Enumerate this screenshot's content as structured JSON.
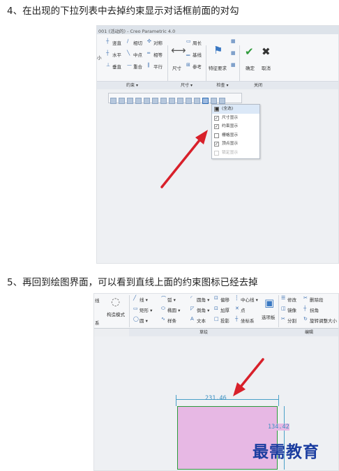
{
  "step4": "4、在出现的下拉列表中去掉约束显示对话框前面的对勾",
  "step5": "5、再回到绘图界面，可以看到直线上面的约束图标已经去掉",
  "shot1": {
    "window_title": "001 (活动的) - Creo Parametric 4.0",
    "constraints": {
      "row1": [
        "竖直",
        "相切",
        "对称"
      ],
      "row2": [
        "水平",
        "中点",
        "相等"
      ],
      "row3": [
        "垂直",
        "重合",
        "平行"
      ],
      "left_edge": "小",
      "group": "约束 ▾"
    },
    "dimension": {
      "label": "尺寸",
      "items": [
        "周长",
        "基线",
        "参考"
      ],
      "group": "尺寸 ▾"
    },
    "inspect": {
      "label": "特征要求",
      "group": "检查 ▾"
    },
    "close": {
      "ok": "确定",
      "cancel": "取消",
      "group": "关闭"
    },
    "dropdown": [
      {
        "label": "(全选)",
        "checked": true,
        "disabled": false,
        "highlight": true
      },
      {
        "label": "尺寸显示",
        "checked": true,
        "disabled": false,
        "highlight": false
      },
      {
        "label": "约束显示",
        "checked": true,
        "disabled": false,
        "highlight": false
      },
      {
        "label": "栅格显示",
        "checked": false,
        "disabled": false,
        "highlight": false
      },
      {
        "label": "顶点显示",
        "checked": true,
        "disabled": false,
        "highlight": false
      },
      {
        "label": "锁定显示",
        "checked": false,
        "disabled": true,
        "highlight": false
      }
    ]
  },
  "shot2": {
    "left_edge": [
      "线",
      "系"
    ],
    "construct_mode": "构造模式",
    "sketch_tools": {
      "col1": [
        "线 ▾",
        "矩形 ▾",
        "圆 ▾"
      ],
      "col2": [
        "弧 ▾",
        "椭圆 ▾",
        "样条"
      ],
      "col3": [
        "圆角 ▾",
        "倒角 ▾",
        "文本"
      ],
      "col4": [
        "偏移",
        "加厚",
        "投影"
      ],
      "col5": [
        "中心线 ▾",
        "点",
        "坐标系"
      ]
    },
    "palette": "选项板",
    "edit_tools": [
      "修改",
      "删除段",
      "镜像",
      "拐角",
      "分割",
      "旋转调整大小"
    ],
    "group_sketch": "草绘",
    "group_edit": "编辑",
    "dim_horizontal": "231.46",
    "dim_vertical": "134.42",
    "watermark": "最需教育"
  },
  "colors": {
    "arrow": "#d8202a",
    "sketch_fill": "#e7b8e4",
    "sketch_edge": "#2d9b3c",
    "dimension": "#3a8fc0",
    "watermark": "#1c3ea0"
  }
}
